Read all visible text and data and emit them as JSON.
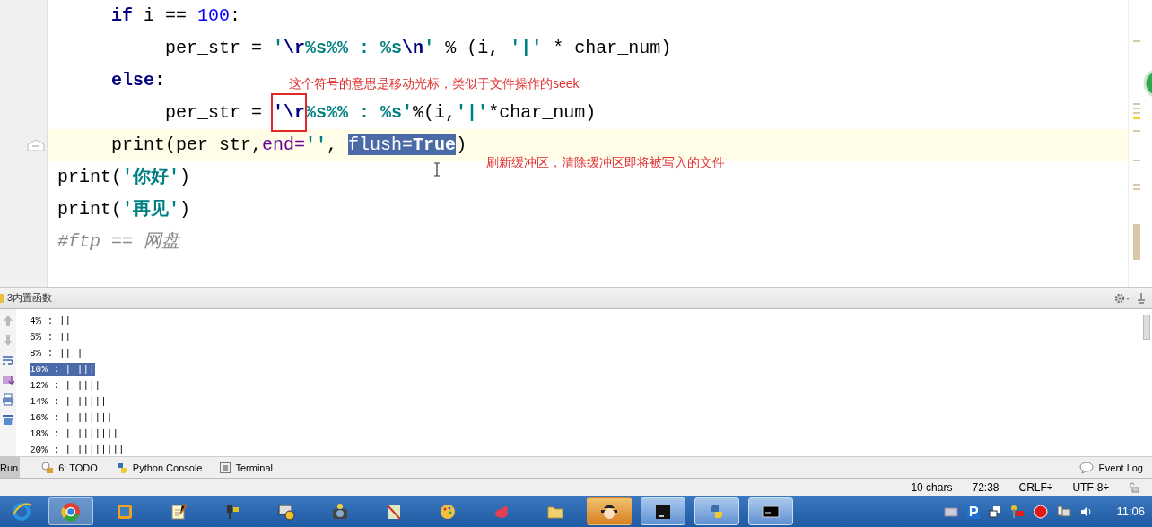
{
  "editor": {
    "lines": [
      {
        "current": false,
        "segments": [
          {
            "text": "     if",
            "kind": "keyword",
            "selected": false,
            "boxed": false
          },
          {
            "text": " i == ",
            "kind": "plain",
            "selected": false,
            "boxed": false
          },
          {
            "text": "100",
            "kind": "number",
            "selected": false,
            "boxed": false
          },
          {
            "text": ":",
            "kind": "plain",
            "selected": false,
            "boxed": false
          }
        ]
      },
      {
        "current": false,
        "segments": [
          {
            "text": "          per_str = ",
            "kind": "plain",
            "selected": false,
            "boxed": false
          },
          {
            "text": "'",
            "kind": "string",
            "selected": false,
            "boxed": false
          },
          {
            "text": "\\r",
            "kind": "escape",
            "selected": false,
            "boxed": false
          },
          {
            "text": "%s%% : %s",
            "kind": "string",
            "selected": false,
            "boxed": false
          },
          {
            "text": "\\n",
            "kind": "escape",
            "selected": false,
            "boxed": false
          },
          {
            "text": "'",
            "kind": "string",
            "selected": false,
            "boxed": false
          },
          {
            "text": " % (i, ",
            "kind": "plain",
            "selected": false,
            "boxed": false
          },
          {
            "text": "'|'",
            "kind": "string",
            "selected": false,
            "boxed": false
          },
          {
            "text": " * char_num)",
            "kind": "plain",
            "selected": false,
            "boxed": false
          }
        ]
      },
      {
        "current": false,
        "segments": [
          {
            "text": "     else",
            "kind": "keyword",
            "selected": false,
            "boxed": false
          },
          {
            "text": ":",
            "kind": "plain",
            "selected": false,
            "boxed": false
          }
        ]
      },
      {
        "current": false,
        "segments": [
          {
            "text": "          per_str = ",
            "kind": "plain",
            "selected": false,
            "boxed": false
          },
          {
            "text": "'\\r",
            "kind": "escape",
            "selected": false,
            "boxed": true
          },
          {
            "text": "%s%% : %s'",
            "kind": "string",
            "selected": false,
            "boxed": false
          },
          {
            "text": "%(i,",
            "kind": "plain",
            "selected": false,
            "boxed": false
          },
          {
            "text": "'|'",
            "kind": "string",
            "selected": false,
            "boxed": false
          },
          {
            "text": "*char_num)",
            "kind": "plain",
            "selected": false,
            "boxed": false
          }
        ]
      },
      {
        "current": true,
        "segments": [
          {
            "text": "     print(per_str,",
            "kind": "plain",
            "selected": false,
            "boxed": false
          },
          {
            "text": "end=",
            "kind": "param",
            "selected": false,
            "boxed": false
          },
          {
            "text": "''",
            "kind": "string",
            "selected": false,
            "boxed": false
          },
          {
            "text": ", ",
            "kind": "plain",
            "selected": false,
            "boxed": false
          },
          {
            "text": "flush=",
            "kind": "param",
            "selected": true,
            "boxed": false
          },
          {
            "text": "True",
            "kind": "keyword",
            "selected": true,
            "boxed": false
          },
          {
            "text": ")",
            "kind": "plain",
            "selected": false,
            "boxed": false
          }
        ]
      },
      {
        "current": false,
        "segments": [
          {
            "text": "print(",
            "kind": "plain",
            "selected": false,
            "boxed": false
          },
          {
            "text": "'你好'",
            "kind": "string",
            "selected": false,
            "boxed": false
          },
          {
            "text": ")",
            "kind": "plain",
            "selected": false,
            "boxed": false
          }
        ]
      },
      {
        "current": false,
        "segments": [
          {
            "text": "print(",
            "kind": "plain",
            "selected": false,
            "boxed": false
          },
          {
            "text": "'再见'",
            "kind": "string",
            "selected": false,
            "boxed": false
          },
          {
            "text": ")",
            "kind": "plain",
            "selected": false,
            "boxed": false
          }
        ]
      },
      {
        "current": false,
        "segments": [
          {
            "text": "#ftp == 网盘",
            "kind": "comment",
            "selected": false,
            "boxed": false
          }
        ]
      }
    ],
    "annotations": [
      {
        "text": "这个符号的意思是移动光标，类似于文件操作的seek"
      },
      {
        "text": "刷新缓冲区，清除缓冲区即将被写入的文件"
      }
    ]
  },
  "run_panel": {
    "title": "3内置函数",
    "lines": [
      {
        "text": "4% : ||",
        "selected": false
      },
      {
        "text": "6% : |||",
        "selected": false
      },
      {
        "text": "8% : ||||",
        "selected": false
      },
      {
        "text": "10% : |||||",
        "selected": true
      },
      {
        "text": "12% : ||||||",
        "selected": false
      },
      {
        "text": "14% : |||||||",
        "selected": false
      },
      {
        "text": "16% : ||||||||",
        "selected": false
      },
      {
        "text": "18% : |||||||||",
        "selected": false
      },
      {
        "text": "20% : ||||||||||",
        "selected": false
      }
    ]
  },
  "tool_tabs": [
    {
      "label": "Run",
      "selected": true
    },
    {
      "label": "6: TODO",
      "selected": false
    },
    {
      "label": "Python Console",
      "selected": false
    },
    {
      "label": "Terminal",
      "selected": false
    }
  ],
  "event_log": "Event Log",
  "status_bar": {
    "selection": "10 chars",
    "position": "72:38",
    "line_separator": "CRLF÷",
    "encoding": "UTF-8÷"
  },
  "taskbar": {
    "clock": "11:06"
  }
}
